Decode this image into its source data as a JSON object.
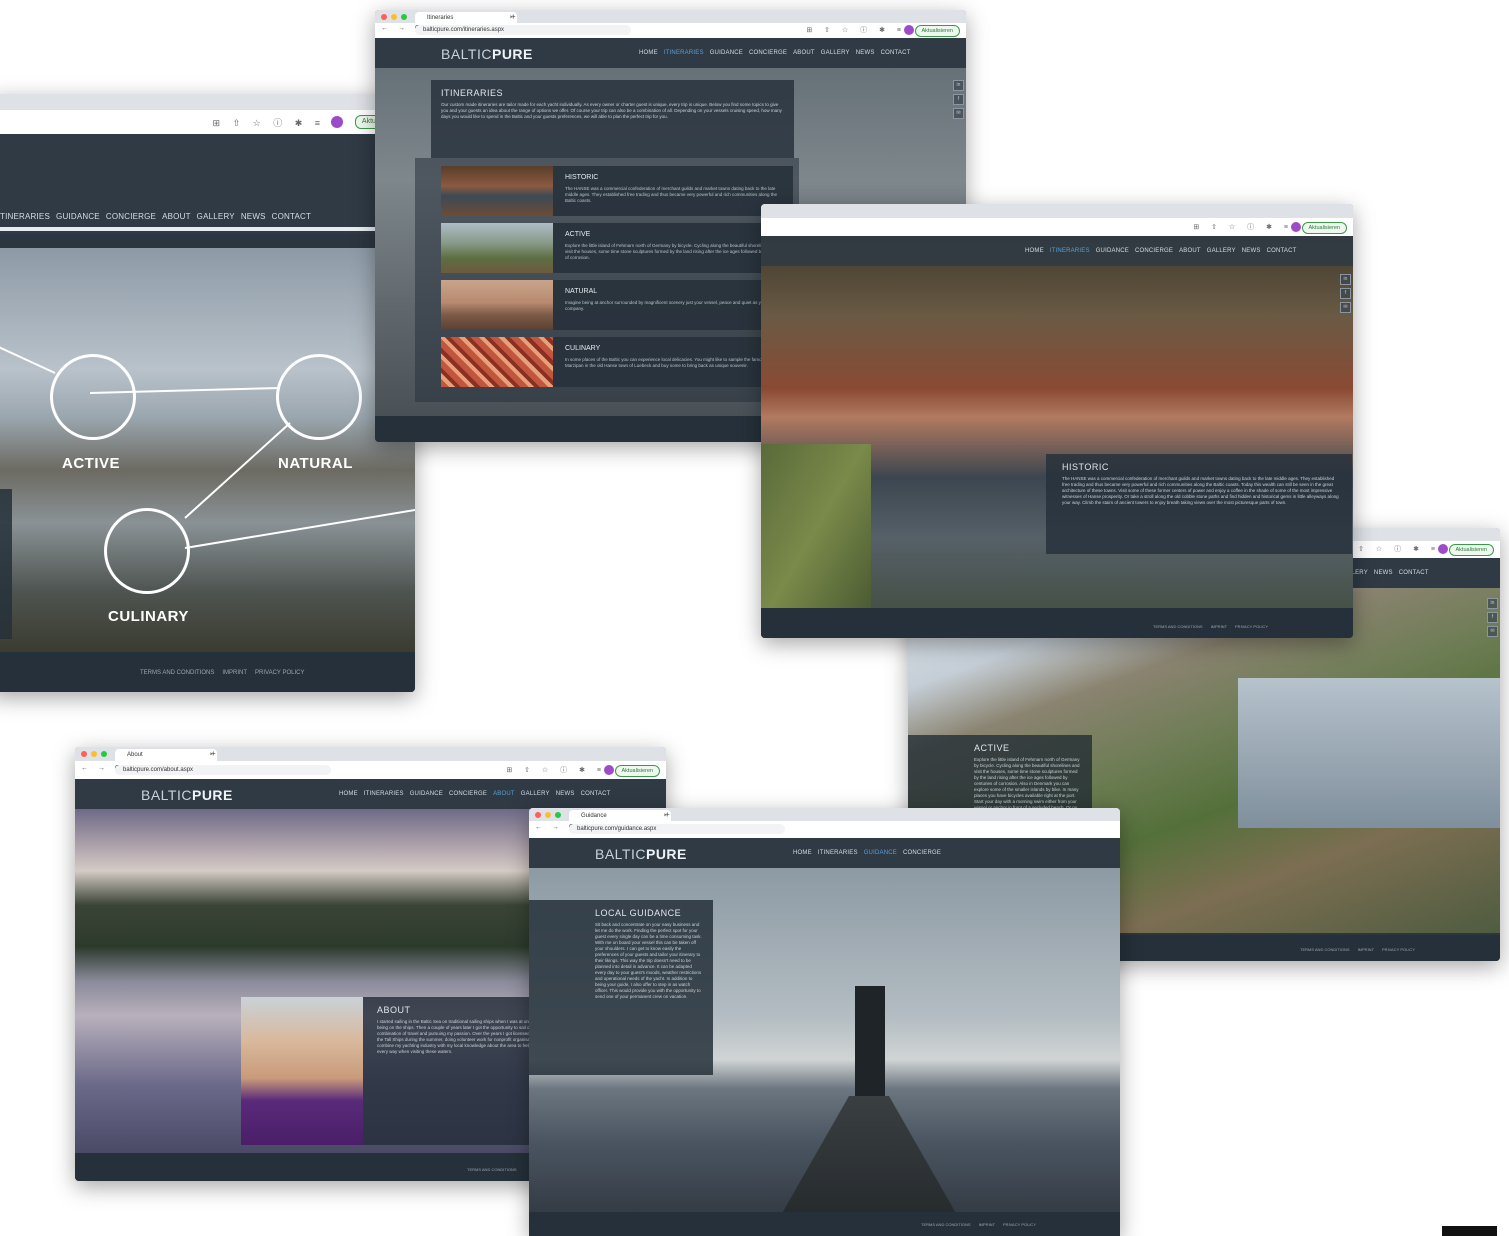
{
  "browser": {
    "update_label": "Aktualisieren",
    "new_tab_icon": "+",
    "close_tab_icon": "×",
    "nav_icons": "← → C",
    "toolbar_icons": "⊞ ⇧ ☆ ⓘ ✱ ≡",
    "avatar": "K"
  },
  "site": {
    "logo_light": "BALTIC",
    "logo_bold": "PURE",
    "nav": [
      "HOME",
      "ITINERARIES",
      "GUIDANCE",
      "CONCIERGE",
      "ABOUT",
      "GALLERY",
      "NEWS",
      "CONTACT"
    ],
    "nav_partial": [
      "TINERARIES",
      "GUIDANCE",
      "CONCIERGE",
      "ABOUT",
      "GALLERY",
      "NEWS",
      "CONTACT"
    ],
    "nav_partial_right": [
      "LLERY",
      "NEWS",
      "CONTACT"
    ],
    "footer": [
      "TERMS AND CONDITIONS",
      "IMPRINT",
      "PRIVACY POLICY"
    ],
    "social_icons": [
      "linkedin-icon",
      "facebook-icon",
      "mail-icon"
    ]
  },
  "home_window": {
    "labels": {
      "active": "ACTIVE",
      "natural": "NATURAL",
      "culinary": "CULINARY"
    }
  },
  "itineraries_window": {
    "tab_title": "Itineraries",
    "url": "balticpure.com/itineraries.aspx",
    "intro_title": "ITINERARIES",
    "intro_text": "Our custom made itineraries are tailor made for each yacht individually. As every owner or charter guest is unique, every trip is unique. Below you find some topics to give you and your guests an idea about the range of options we offer. Of course your trip can also be a combination of all. Depending on your vessels cruising speed, how many days you would like to spend in the Baltic and your guests preferences, we will able to plan the perfect trip for you.",
    "rows": [
      {
        "title": "HISTORIC",
        "text": "The HANSE was a commercial confederation of merchant guilds and market towns dating back to the late middle ages. They established free trading and thus became very powerful and rich communities along the Baltic coasts."
      },
      {
        "title": "ACTIVE",
        "text": "Explore the little island of Fehmarn north of Germany by bicycle. Cycling along the beautiful shorelines and visit the houses, some time stone sculptures formed by the land rising after the ice ages followed by centuries of corrosion."
      },
      {
        "title": "NATURAL",
        "text": "Imagine being at anchor surrounded by magnificent scenery just your vessel, peace and quiet as your only company."
      },
      {
        "title": "CULINARY",
        "text": "In some places of the Baltic you can experience local delicacies. You might like to sample the famous Marzipan in the old Hanse town of Luebeck and buy some to bring back as unique souvenir."
      }
    ]
  },
  "historic_window": {
    "title": "HISTORIC",
    "text": "The HANSE was a commercial confederation of merchant guilds and market towns dating back to the late middle ages. They established free trading and thus became very powerful and rich communities along the Baltic coasts. Today this wealth can still be seen in the great architecture of these towns. Visit some of these former centers of power and enjoy a coffee in the shade of some of the most impressive witnesses of Hanse prosperity. Or take a stroll along the old cobble stone paths and find hidden and historical gems in little alleyways along your way. Climb the stairs of ancient towers to enjoy breath taking views over the most picturesque parts of town."
  },
  "active_window": {
    "title": "ACTIVE",
    "text": "Explore the little island of Fehmarn north of Germany by bicycle. Cycling along the beautiful shorelines and visit the houses, some time stone sculptures formed by the land rising after the ice ages followed by centuries of corrosion. Also in Denmark you can explore some of the smaller islands by bike. In many places you have bicycles available right at the port. Start your day with a morning swim either from your vessel or anchor in front of a secluded beach. Or go on a half day or three hour hike along the shores of Bornholm. Ristinge or one of the smaller Danish islands. The possibilities are endless."
  },
  "about_window": {
    "tab_title": "About",
    "url": "balticpure.com/about.aspx",
    "title": "ABOUT",
    "text": "I started sailing in the Baltic Sea on traditional sailing ships when I was at university. It soon became obvious that this is my passion. I loved being on the ships. Then a couple of years later I got the opportunity to sail on a large modern sailing yacht. And there it was: the perfect combination of travel and pursuing my passion. Over the years I got licensed and worked on yachts. I still spent a fair amount of my time on the Tall Ships during the summer, doing volunteer work for nonprofit organisations. As I love the Baltic and know its potential, I decided to combine my yachting industry with my local knowledge about the area to help you. These attributes I can assist you and your guests in every way when visiting these waters."
  },
  "guidance_window": {
    "tab_title": "Guidance",
    "url": "balticpure.com/guidance.aspx",
    "title": "LOCAL GUIDANCE",
    "text": "Sit back and concentrate on your easy business and let me do the work. Finding the perfect spot for your guest every single day can be a time consuming task. With me on board your vessel this can be taken off your shoulders. I can get to know easily the preferences of your guests and tailor your itinerary to their likings. This way the trip doesn't need to be planned into detail in advance. It can be adapted every day to your guest's moods, weather restrictions and operational needs of the yacht. In addition to being your guide, I also offer to step in as watch officer. This would provide you with the opportunity to send one of your permanent crew on vacation."
  },
  "colors": {
    "accent": "#58a0d6",
    "header": "#2f3a45",
    "footer": "#25303a",
    "update_green": "#2a7a3a"
  }
}
